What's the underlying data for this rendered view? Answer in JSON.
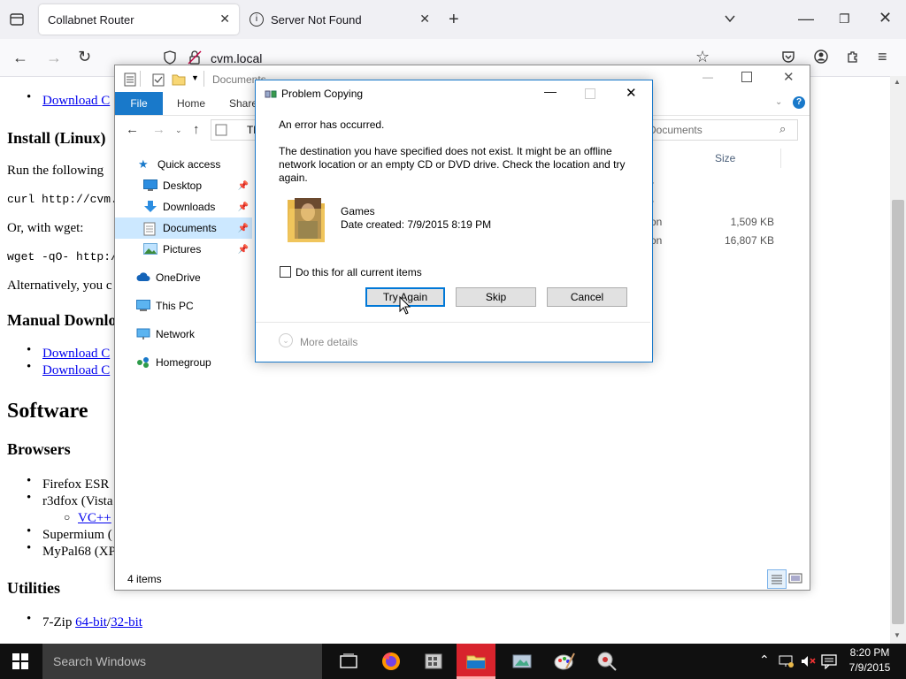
{
  "browser": {
    "tabs": [
      {
        "title": "Collabnet Router",
        "active": true
      },
      {
        "title": "Server Not Found",
        "active": false
      }
    ],
    "url": "cvm.local"
  },
  "webpage": {
    "list1": [
      "Download C"
    ],
    "install_linux": "Install (Linux)",
    "run_following": "Run the following",
    "curl_cmd": "curl http://cvm.lo",
    "or_wget": "Or, with wget:",
    "wget_cmd": "wget -qO- http://c",
    "alternatively": "Alternatively, you c",
    "manual_download": "Manual Downlo",
    "manual_links": [
      "Download C",
      "Download C"
    ],
    "software": "Software",
    "browsers": "Browsers",
    "browser_items": [
      "Firefox ESR",
      "r3dfox (Vista",
      "Supermium (",
      "MyPal68 (XP"
    ],
    "vc_link": "VC++",
    "utilities": "Utilities",
    "zip_text": "7-Zip ",
    "zip_64": "64-bit",
    "zip_sep": "/",
    "zip_32": "32-bit"
  },
  "explorer": {
    "breadcrumb": "Documents",
    "ribbon_tabs": [
      "File",
      "Home",
      "Share"
    ],
    "address_stub": "Th",
    "search_placeholder": "h Documents",
    "column_size": "Size",
    "rows": [
      {
        "type": "r",
        "size": ""
      },
      {
        "type": "r",
        "size": ""
      },
      {
        "type": "on",
        "size": "1,509 KB"
      },
      {
        "type": "on",
        "size": "16,807 KB"
      }
    ],
    "nav": {
      "quick_access": "Quick access",
      "desktop": "Desktop",
      "downloads": "Downloads",
      "documents": "Documents",
      "pictures": "Pictures",
      "onedrive": "OneDrive",
      "this_pc": "This PC",
      "network": "Network",
      "homegroup": "Homegroup"
    },
    "status_items": "4 items"
  },
  "dialog": {
    "title": "Problem Copying",
    "error": "An error has occurred.",
    "message": "The destination you have specified does not exist. It might be an offline network location or an empty CD or DVD drive. Check the location and try again.",
    "item_name": "Games",
    "item_date": "Date created: 7/9/2015 8:19 PM",
    "checkbox_label": "Do this for all current items",
    "btn_try_again": "Try Again",
    "btn_skip": "Skip",
    "btn_cancel": "Cancel",
    "more_details": "More details"
  },
  "taskbar": {
    "search_placeholder": "Search Windows",
    "time": "8:20 PM",
    "date": "7/9/2015"
  },
  "colors": {
    "accent": "#1979ca",
    "taskbar": "#101010",
    "link": "#0000ee"
  }
}
